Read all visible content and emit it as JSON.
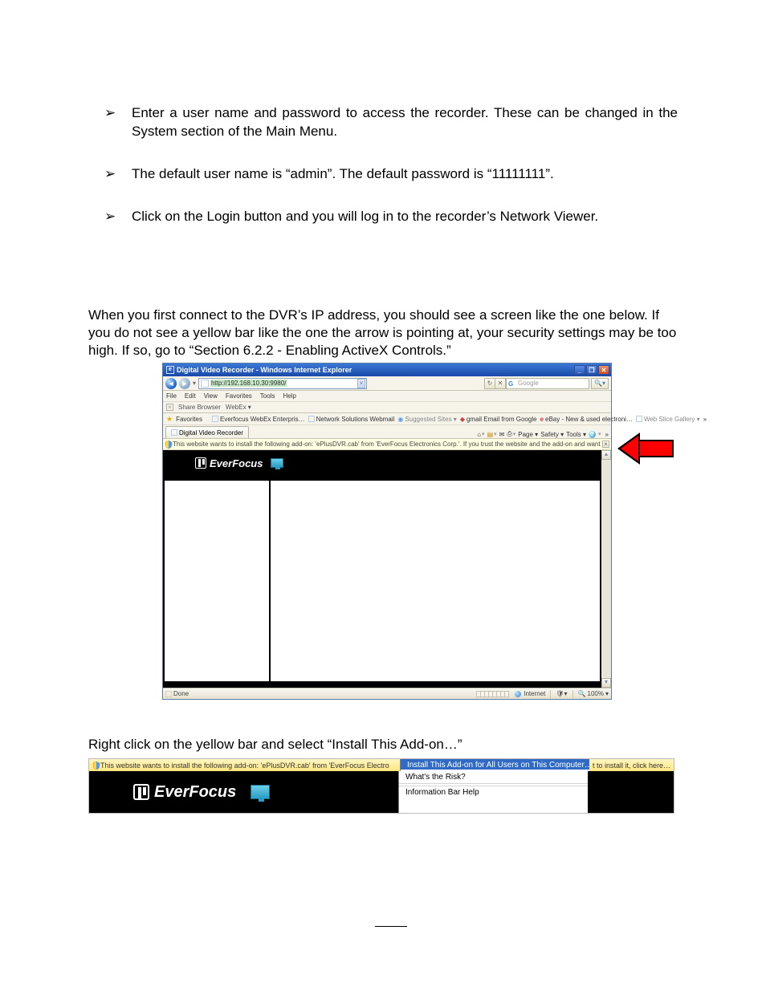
{
  "bullets": [
    "Enter a user name and password to access the recorder. These can be changed in the System section of the Main Menu.",
    "The default user name is “admin”. The default password is “11111111”.",
    "Click on the Login button and you will log in to the recorder’s Network Viewer."
  ],
  "para1": "When you first connect to the DVR’s IP address, you should see a screen like the one below. If you do not see a yellow bar like the one the arrow is pointing at, your security settings may be too high. If so, go to “Section 6.2.2 - Enabling ActiveX Controls.”",
  "para2": "Right click on the yellow bar and select “Install This Add-on…”",
  "ie": {
    "title": "Digital Video Recorder - Windows Internet Explorer",
    "address": "http://192.168.10.30:9980/",
    "menu": [
      "File",
      "Edit",
      "View",
      "Favorites",
      "Tools",
      "Help"
    ],
    "share": {
      "browser": "Share Browser",
      "webex": "WebEx ▾"
    },
    "fav": {
      "label": "Favorites",
      "links": [
        "Everfocus WebEx Enterpris…",
        "Network Solutions Webmail",
        "Suggested Sites ▾",
        "gmail Email from Google",
        "eBay - New & used electroni…",
        "Web Slice Gallery ▾"
      ]
    },
    "tab": "Digital Video Recorder",
    "tools": {
      "page": "Page ▾",
      "safety": "Safety ▾",
      "tools": "Tools ▾"
    },
    "infobar": "This website wants to install the following add-on: 'ePlusDVR.cab' from 'EverFocus Electronics Corp.'. If you trust the website and the add-on and want to install it, click here…",
    "search_provider": "Google",
    "status_done": "Done",
    "status_zone": "Internet",
    "status_zoom": "100%",
    "brand": "EverFocus"
  },
  "ss2": {
    "infobar_left": "This website wants to install the following add-on: 'ePlusDVR.cab' from 'EverFocus Electro",
    "infobar_right": "t to install it, click here…",
    "menu": [
      "Install This Add-on for All Users on This Computer…",
      "What's the Risk?",
      "Information Bar Help"
    ],
    "brand": "EverFocus"
  }
}
